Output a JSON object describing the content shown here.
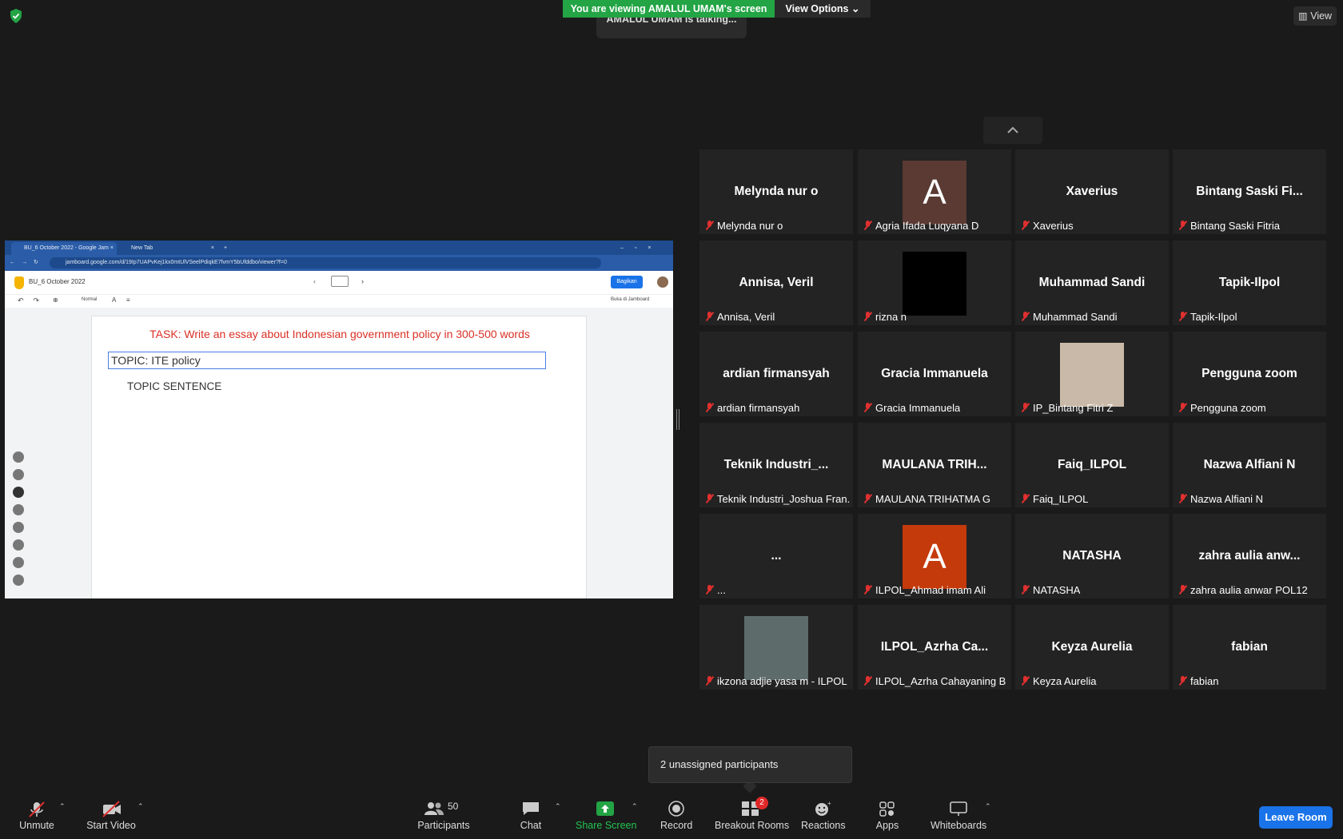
{
  "banner": {
    "viewing": "You are viewing AMALUL UMAM's screen",
    "view_options": "View Options",
    "talking": "AMALUL UMAM is talking...",
    "view": "View"
  },
  "shared_screen": {
    "tabs": [
      "BU_6 October 2022 - Google Jam",
      "New Tab"
    ],
    "url": "jamboard.google.com/d/19Ip7UAPvKej1kx0mtUlVSeelPdiqkE7fvmY5bUfddbo/viewer?f=0",
    "doc_title": "BU_6 October 2022",
    "share_button": "Bagikan",
    "open_in": "Buka di Jamboard",
    "font_style": "Normal",
    "task": "TASK: Write an essay about Indonesian government policy in 300-500 words",
    "topic": "TOPIC: ITE policy",
    "topic_sentence": "TOPIC SENTENCE"
  },
  "participants_grid": [
    {
      "tile": "Melynda nur o",
      "label": "Melynda nur o",
      "avatar": null
    },
    {
      "tile": "",
      "label": "Agria Ifada Luqyana D",
      "avatar": {
        "letter": "A",
        "color": "#5a3a33"
      }
    },
    {
      "tile": "Xaverius",
      "label": "Xaverius",
      "avatar": null
    },
    {
      "tile": "Bintang Saski Fi...",
      "label": "Bintang Saski Fitria",
      "avatar": null
    },
    {
      "tile": "Annisa, Veril",
      "label": "Annisa, Veril",
      "avatar": null
    },
    {
      "tile": "",
      "label": "rizna n",
      "avatar": {
        "letter": "",
        "color": "#000000"
      }
    },
    {
      "tile": "Muhammad Sandi",
      "label": "Muhammad Sandi",
      "avatar": null
    },
    {
      "tile": "Tapik-Ilpol",
      "label": "Tapik-Ilpol",
      "avatar": null
    },
    {
      "tile": "ardian firmansyah",
      "label": "ardian firmansyah",
      "avatar": null
    },
    {
      "tile": "Gracia Immanuela",
      "label": "Gracia Immanuela",
      "avatar": null
    },
    {
      "tile": "",
      "label": "IP_Bintang Fitri Z",
      "avatar": {
        "letter": "",
        "color": "#c9b9a8"
      }
    },
    {
      "tile": "Pengguna zoom",
      "label": "Pengguna zoom",
      "avatar": null
    },
    {
      "tile": "Teknik Industri_...",
      "label": "Teknik Industri_Joshua Fran...",
      "avatar": null
    },
    {
      "tile": "MAULANA TRIH...",
      "label": "MAULANA TRIHATMA G",
      "avatar": null
    },
    {
      "tile": "Faiq_ILPOL",
      "label": "Faiq_ILPOL",
      "avatar": null
    },
    {
      "tile": "Nazwa Alfiani N",
      "label": "Nazwa Alfiani N",
      "avatar": null
    },
    {
      "tile": "...",
      "label": "...",
      "avatar": null
    },
    {
      "tile": "",
      "label": "ILPOL_Ahmad imam Ali",
      "avatar": {
        "letter": "A",
        "color": "#c43a0b"
      }
    },
    {
      "tile": "NATASHA",
      "label": "NATASHA",
      "avatar": null
    },
    {
      "tile": "zahra aulia anw...",
      "label": "zahra aulia anwar POL12",
      "avatar": null
    },
    {
      "tile": "",
      "label": "ikzona adjie yasa m - ILPOL",
      "avatar": {
        "letter": "",
        "color": "#5d6b6a"
      }
    },
    {
      "tile": "ILPOL_Azrha Ca...",
      "label": "ILPOL_Azrha Cahayaning B",
      "avatar": null
    },
    {
      "tile": "Keyza Aurelia",
      "label": "Keyza Aurelia",
      "avatar": null
    },
    {
      "tile": "fabian",
      "label": "fabian",
      "avatar": null
    }
  ],
  "unassigned_popup": "2 unassigned participants",
  "toolbar": {
    "unmute": "Unmute",
    "start_video": "Start Video",
    "participants": "Participants",
    "participants_count": "50",
    "chat": "Chat",
    "share_screen": "Share Screen",
    "record": "Record",
    "breakout_rooms": "Breakout Rooms",
    "breakout_badge": "2",
    "reactions": "Reactions",
    "apps": "Apps",
    "whiteboards": "Whiteboards",
    "leave_room": "Leave Room"
  }
}
